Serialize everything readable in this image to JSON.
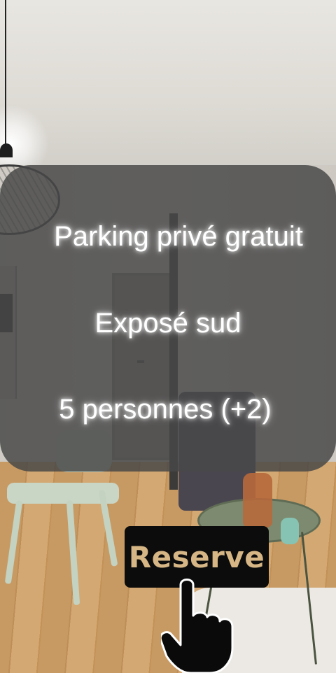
{
  "features": [
    "Parking privé gratuit",
    "Exposé sud",
    "5 personnes (+2)"
  ],
  "cta": {
    "label": "Reserve",
    "text_color": "#d6b685",
    "background": "#0c0c0c",
    "icon": "pointing-hand-icon"
  },
  "overlay": {
    "background": "rgba(72,72,72,0.84)"
  }
}
